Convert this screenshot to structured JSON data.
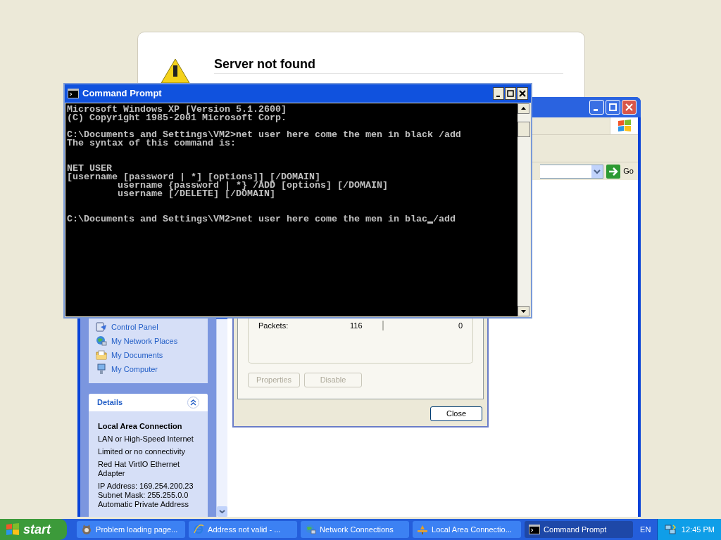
{
  "browser_page": {
    "heading": "Server not found"
  },
  "explorer": {
    "go_button": "Go",
    "places": [
      {
        "label": "Control Panel",
        "kind": "control"
      },
      {
        "label": "My Network Places",
        "kind": "network"
      },
      {
        "label": "My Documents",
        "kind": "documents"
      },
      {
        "label": "My Computer",
        "kind": "computer"
      }
    ],
    "details": {
      "title": "Details",
      "expanded": true,
      "name": "Local Area Connection",
      "lines": [
        "LAN or High-Speed Internet",
        "Limited or no connectivity",
        "Red Hat VirtIO Ethernet Adapter"
      ],
      "address_lines": [
        "IP Address: 169.254.200.23",
        "Subnet Mask: 255.255.0.0",
        "Automatic Private Address"
      ]
    }
  },
  "status_dialog": {
    "rows": [
      {
        "label": "Packets:",
        "sent": "116",
        "received": "0"
      }
    ],
    "buttons": [
      {
        "label": "Properties",
        "disabled": true
      },
      {
        "label": "Disable",
        "disabled": true
      }
    ],
    "close": "Close"
  },
  "command_prompt": {
    "title": "Command Prompt",
    "blocks": [
      [
        "Microsoft Windows XP [Version 5.1.2600]",
        "(C) Copyright 1985-2001 Microsoft Corp."
      ],
      [
        "C:\\Documents and Settings\\VM2>net user here come the men in black /add",
        "The syntax of this command is:"
      ],
      [
        "NET USER",
        "[username [password | *] [options]] [/DOMAIN]",
        "         username {password | *} /ADD [options] [/DOMAIN]",
        "         username [/DELETE] [/DOMAIN]"
      ]
    ],
    "input": {
      "before_cursor": "C:\\Documents and Settings\\VM2>net user here come the men in blac",
      "after_cursor": "/add"
    }
  },
  "taskbar": {
    "start": "start",
    "items": [
      {
        "label": "Problem loading page...",
        "kind": "browser",
        "selected": false
      },
      {
        "label": "Address not valid - ...",
        "kind": "ie",
        "selected": false
      },
      {
        "label": "Network Connections",
        "kind": "network",
        "selected": false
      },
      {
        "label": "Local Area Connectio...",
        "kind": "lan",
        "selected": false
      },
      {
        "label": "Command Prompt",
        "kind": "cmd",
        "selected": true
      }
    ],
    "language": "EN",
    "clock": "12:45 PM"
  }
}
